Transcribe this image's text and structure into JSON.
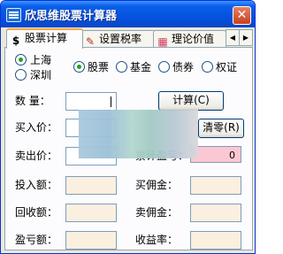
{
  "window": {
    "title": "欣思维股票计算器",
    "close_glyph": "✕"
  },
  "tabs": [
    {
      "label": "股票计算",
      "icon": "dollar-icon",
      "glyph": "$"
    },
    {
      "label": "设置税率",
      "icon": "book-icon",
      "glyph": "✎"
    },
    {
      "label": "理论价值",
      "icon": "grid-icon",
      "glyph": "▦"
    }
  ],
  "tab_scroll": {
    "left": "◀",
    "right": "▶"
  },
  "market": {
    "options": [
      "上海",
      "深圳"
    ],
    "selected": "上海"
  },
  "security_type": {
    "options": [
      "股票",
      "基金",
      "债券",
      "权证"
    ],
    "selected": "股票"
  },
  "labels": {
    "quantity": "数 量：",
    "buy_price": "买入价：",
    "sell_price": "卖出价：",
    "cumulative_pl": "累计盈亏：",
    "investment": "投入额：",
    "buy_commission": "买佣金：",
    "recovery": "回收额：",
    "sell_commission": "卖佣金：",
    "profit_loss": "盈亏额：",
    "yield": "收益率："
  },
  "buttons": {
    "calculate": "计算(C)",
    "clear": "清零(R)"
  },
  "values": {
    "cumulative_pl": "0"
  }
}
